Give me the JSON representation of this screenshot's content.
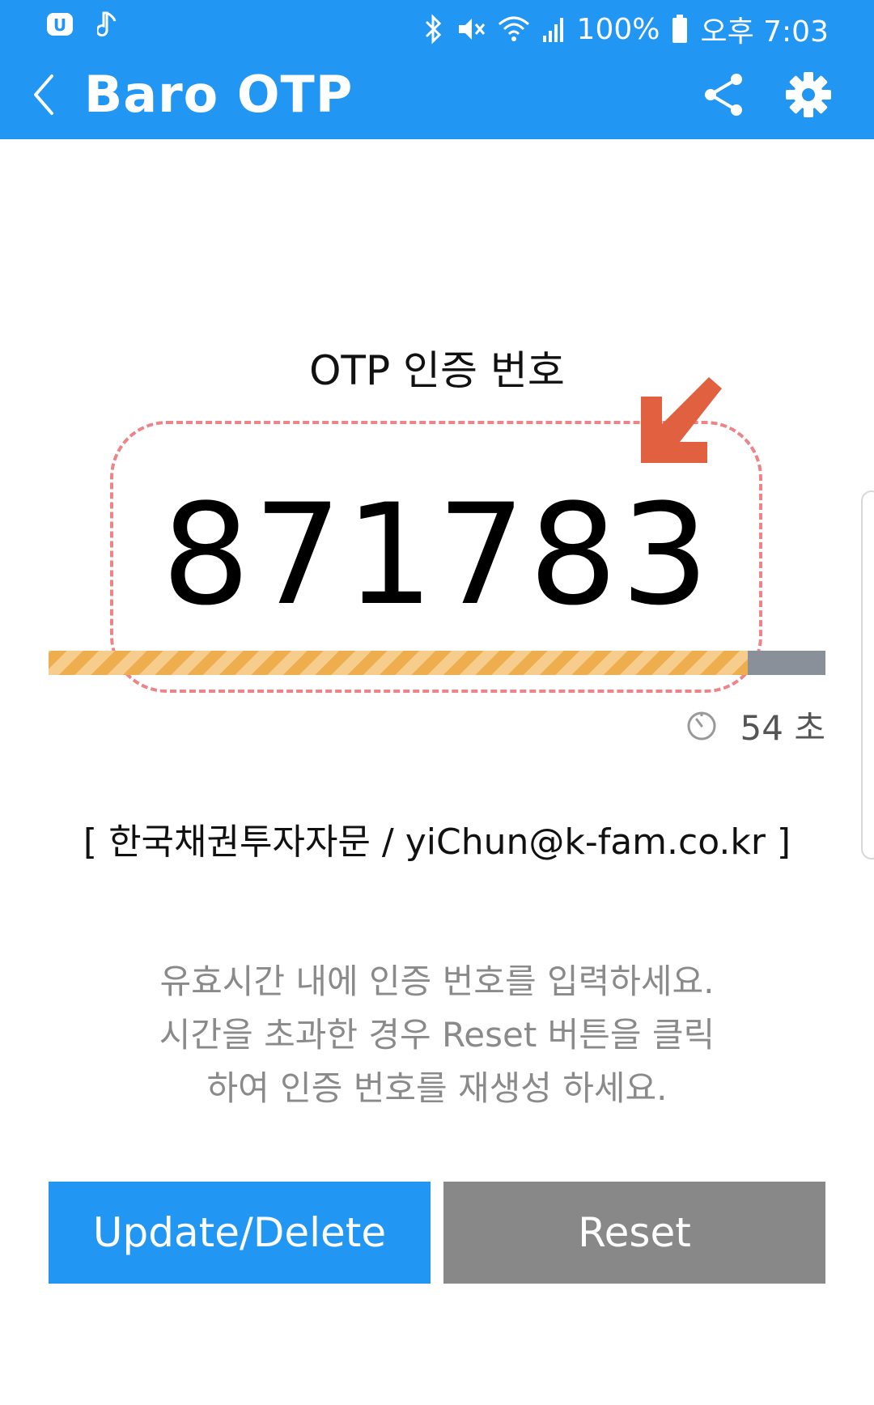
{
  "status_bar": {
    "battery": "100%",
    "time": "오후 7:03",
    "icons": [
      "app-notification-icon",
      "music-note-icon",
      "bluetooth-icon",
      "mute-icon",
      "wifi-icon",
      "signal-icon",
      "battery-icon"
    ]
  },
  "app_bar": {
    "title": "Baro OTP",
    "background_color": "#2196f3"
  },
  "otp": {
    "label": "OTP 인증 번호",
    "code": "871783",
    "progress_fraction": 0.9,
    "remaining_seconds": "54",
    "seconds_unit": "초",
    "highlight_color": "#ec8488",
    "arrow_color": "#e06040"
  },
  "account": {
    "line": "[ 한국채권투자자문 / yiChun@k-fam.co.kr ]"
  },
  "instructions": {
    "line1": "유효시간 내에 인증 번호를 입력하세요.",
    "line2": "시간을 초과한 경우 Reset 버튼을 클릭",
    "line3": "하여 인증 번호를 재생성 하세요."
  },
  "buttons": {
    "update_delete": "Update/Delete",
    "reset": "Reset"
  }
}
